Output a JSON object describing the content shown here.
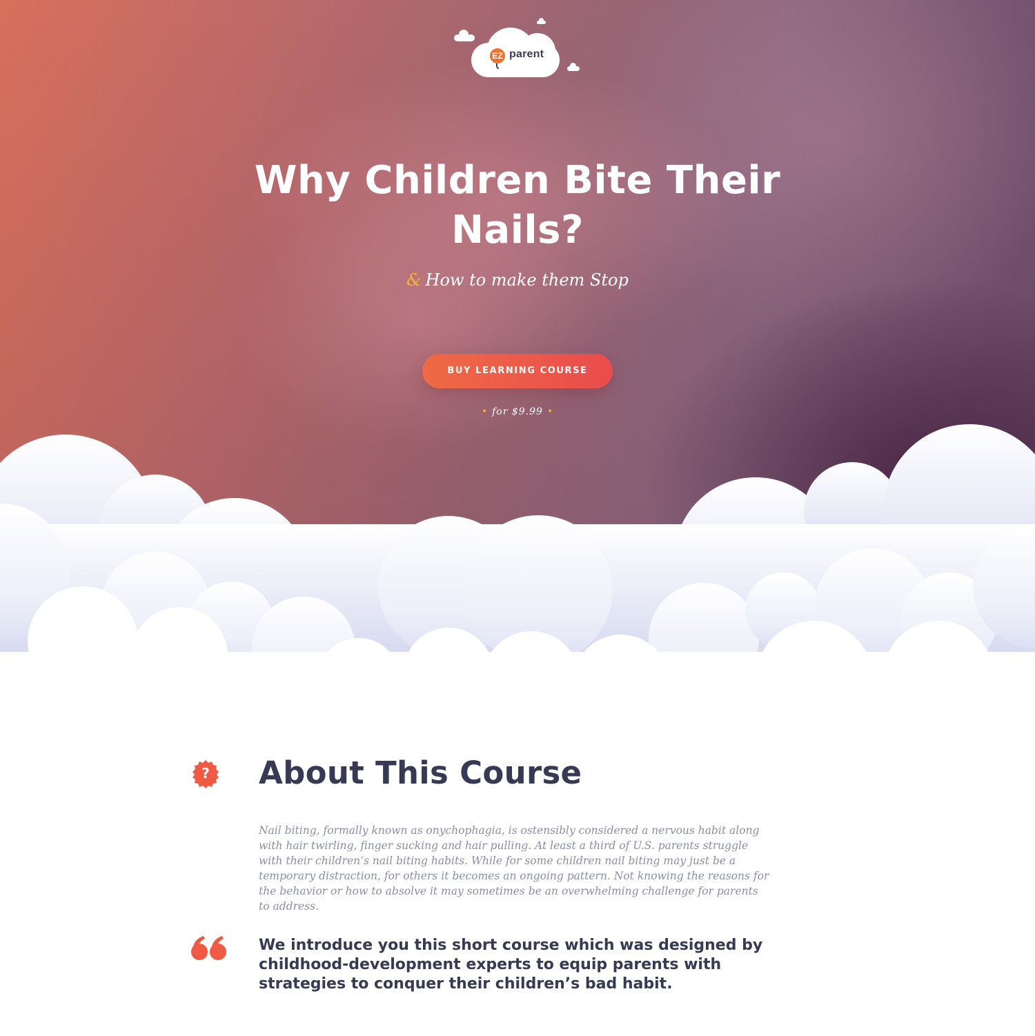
{
  "brand": {
    "logo_mark": "EZ",
    "logo_text": "parent",
    "accent": "#f0702d"
  },
  "hero": {
    "title": "Why Children Bite Their Nails?",
    "subtitle_amp": "&",
    "subtitle": "How to make them Stop",
    "cta_label": "BUY LEARNING COURSE",
    "price": "for $9.99",
    "cta_color": "#ec5a48"
  },
  "about": {
    "icon": "question-badge-icon",
    "title": "About This Course",
    "body": "Nail biting, formally known as onychophagia, is ostensibly considered a nervous habit along with hair twirling, finger sucking and hair pulling. At least a third of U.S. parents struggle with their children’s nail biting habits. While for some children nail biting may just be a temporary distraction, for others it becomes an ongoing pattern. Not knowing the reasons for the behavior or how to absolve it may sometimes be an overwhelming challenge for parents to address.",
    "quote_icon": "quote-icon",
    "quote": "We introduce you this short course which was designed by childhood-development experts to equip parents with strategies to conquer their children’s bad habit."
  }
}
